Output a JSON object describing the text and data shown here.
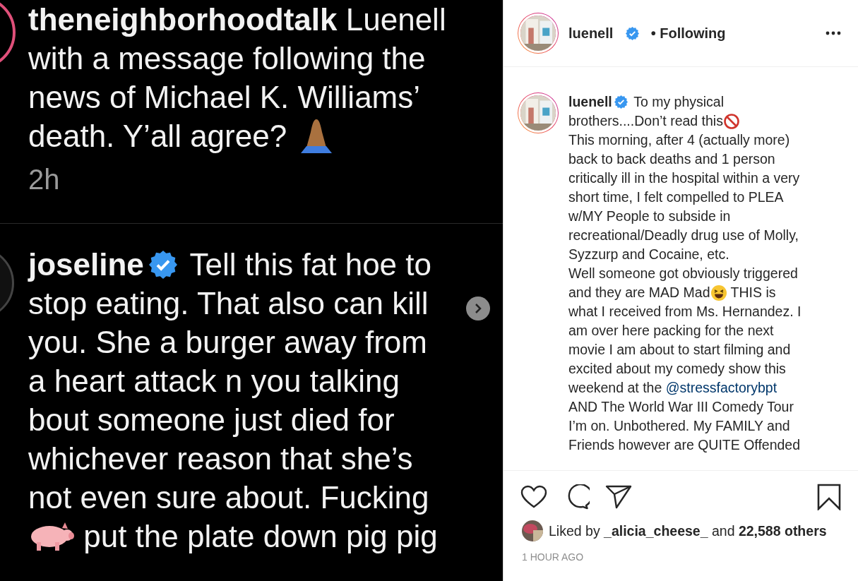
{
  "post_image": {
    "comments": [
      {
        "lines": [
          [
            {
              "kind": "user",
              "text": "theneighborhoodtalk"
            },
            {
              "kind": "text",
              "text": " Luenell"
            }
          ],
          [
            {
              "kind": "text",
              "text": "with a message following the"
            }
          ],
          [
            {
              "kind": "text",
              "text": "news of Michael K. Williams’"
            }
          ],
          [
            {
              "kind": "text",
              "text": "death. Y’all agree? "
            },
            {
              "kind": "pray"
            }
          ]
        ],
        "time": "2h"
      },
      {
        "lines": [
          [
            {
              "kind": "user",
              "text": "joseline"
            },
            {
              "kind": "verified"
            },
            {
              "kind": "text",
              "text": " Tell this fat hoe to"
            }
          ],
          [
            {
              "kind": "text",
              "text": "stop eating. That also can kill"
            }
          ],
          [
            {
              "kind": "text",
              "text": "you. She a burger away from"
            }
          ],
          [
            {
              "kind": "text",
              "text": "a heart attack n you talking"
            }
          ],
          [
            {
              "kind": "text",
              "text": "bout someone just died for"
            }
          ],
          [
            {
              "kind": "text",
              "text": "whichever reason that she’s"
            }
          ],
          [
            {
              "kind": "text",
              "text": "not even sure about. Fucking"
            }
          ],
          [
            {
              "kind": "pig"
            },
            {
              "kind": "text",
              "text": " put the plate down pig pig"
            }
          ]
        ]
      }
    ]
  },
  "header": {
    "username": "luenell",
    "verified": true,
    "follow_status": "• Following"
  },
  "caption": {
    "lines": [
      [
        {
          "kind": "user",
          "text": "luenell"
        },
        {
          "kind": "verified"
        },
        {
          "kind": "text",
          "text": " To my physical"
        }
      ],
      [
        {
          "kind": "text",
          "text": "brothers....Don’t read this"
        },
        {
          "kind": "prohibited"
        }
      ],
      [
        {
          "kind": "text",
          "text": "This morning, after 4 (actually more)"
        }
      ],
      [
        {
          "kind": "text",
          "text": "back to back deaths and 1 person"
        }
      ],
      [
        {
          "kind": "text",
          "text": "critically ill in the hospital within a very"
        }
      ],
      [
        {
          "kind": "text",
          "text": "short time, I felt compelled to PLEA"
        }
      ],
      [
        {
          "kind": "text",
          "text": "w/MY People to subside in"
        }
      ],
      [
        {
          "kind": "text",
          "text": "recreational/Deadly drug use of Molly,"
        }
      ],
      [
        {
          "kind": "text",
          "text": "Syzzurp and Cocaine, etc."
        }
      ],
      [
        {
          "kind": "text",
          "text": "Well someone got obviously triggered"
        }
      ],
      [
        {
          "kind": "text",
          "text": "and they are MAD Mad"
        },
        {
          "kind": "laugh"
        },
        {
          "kind": "text",
          "text": " THIS is"
        }
      ],
      [
        {
          "kind": "text",
          "text": "what I received from Ms. Hernandez. I"
        }
      ],
      [
        {
          "kind": "text",
          "text": "am over here packing for the next"
        }
      ],
      [
        {
          "kind": "text",
          "text": "movie I am about to start filming and"
        }
      ],
      [
        {
          "kind": "text",
          "text": "excited about my comedy show this"
        }
      ],
      [
        {
          "kind": "text",
          "text": "weekend at the "
        },
        {
          "kind": "link",
          "text": "@stressfactorybpt"
        }
      ],
      [
        {
          "kind": "text",
          "text": "AND The World War III Comedy Tour"
        }
      ],
      [
        {
          "kind": "text",
          "text": "I’m on. Unbothered. My FAMILY and"
        }
      ],
      [
        {
          "kind": "text",
          "text": "Friends however are QUITE Offended"
        }
      ]
    ]
  },
  "likes": {
    "prefix": "Liked by ",
    "user": "_alicia_cheese_",
    "middle": " and ",
    "count": "22,588 others"
  },
  "time": "1 HOUR AGO"
}
